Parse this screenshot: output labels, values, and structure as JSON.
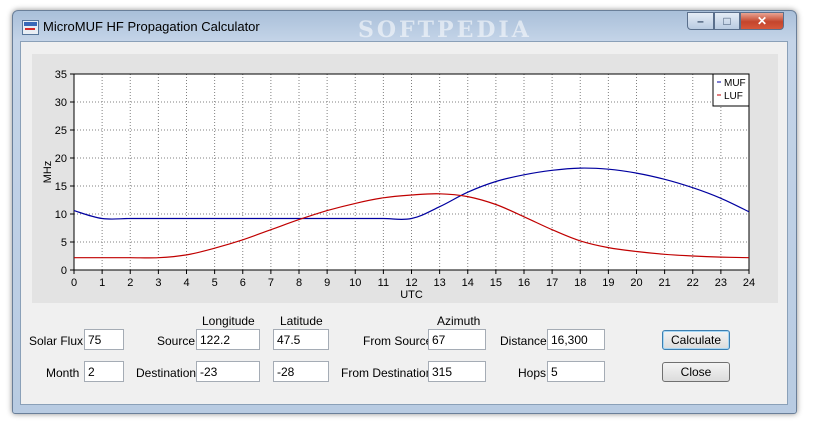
{
  "window": {
    "title": "MicroMUF HF Propagation Calculator",
    "watermark": "SOFTPEDIA",
    "buttons": {
      "minimize_icon": "minimize-icon",
      "maximize_icon": "maximize-icon",
      "close_icon": "close-icon"
    }
  },
  "chart_data": {
    "type": "line",
    "xlabel": "UTC",
    "ylabel": "MHz",
    "xlim": [
      0,
      24
    ],
    "ylim": [
      0,
      35
    ],
    "xticks": [
      "0",
      "1",
      "2",
      "3",
      "4",
      "5",
      "6",
      "7",
      "8",
      "9",
      "10",
      "11",
      "12",
      "13",
      "14",
      "15",
      "16",
      "17",
      "18",
      "19",
      "20",
      "21",
      "22",
      "23",
      "24"
    ],
    "yticks": [
      "0",
      "5",
      "10",
      "15",
      "20",
      "25",
      "30",
      "35"
    ],
    "grid": true,
    "legend_position": "top-right",
    "series": [
      {
        "name": "MUF",
        "color": "#0000a0",
        "x": [
          0,
          1,
          2,
          3,
          4,
          5,
          6,
          7,
          8,
          9,
          10,
          11,
          12,
          13,
          14,
          15,
          16,
          17,
          18,
          19,
          20,
          21,
          22,
          23,
          24
        ],
        "y": [
          10.6,
          9.2,
          9.2,
          9.2,
          9.2,
          9.2,
          9.2,
          9.2,
          9.2,
          9.2,
          9.2,
          9.2,
          9.2,
          11.3,
          13.9,
          15.8,
          17.0,
          17.8,
          18.2,
          18.0,
          17.3,
          16.2,
          14.7,
          12.8,
          10.4
        ]
      },
      {
        "name": "LUF",
        "color": "#c00000",
        "x": [
          0,
          1,
          2,
          3,
          4,
          5,
          6,
          7,
          8,
          9,
          10,
          11,
          12,
          13,
          14,
          15,
          16,
          17,
          18,
          19,
          20,
          21,
          22,
          23,
          24
        ],
        "y": [
          2.2,
          2.2,
          2.2,
          2.2,
          2.7,
          3.9,
          5.4,
          7.2,
          9.0,
          10.6,
          11.9,
          12.9,
          13.4,
          13.6,
          13.1,
          11.7,
          9.5,
          7.2,
          5.2,
          4.0,
          3.3,
          2.8,
          2.5,
          2.3,
          2.2
        ]
      }
    ]
  },
  "form": {
    "headers": {
      "longitude": "Longitude",
      "latitude": "Latitude",
      "azimuth": "Azimuth"
    },
    "solar_flux": {
      "label": "Solar Flux",
      "value": "75"
    },
    "month": {
      "label": "Month",
      "value": "2"
    },
    "source": {
      "label": "Source",
      "longitude": "122.2",
      "latitude": "47.5"
    },
    "destination": {
      "label": "Destination",
      "longitude": "-23",
      "latitude": "-28"
    },
    "from_source": {
      "label": "From Source",
      "value": "67"
    },
    "from_destination": {
      "label": "From Destination",
      "value": "315"
    },
    "distance": {
      "label": "Distance",
      "value": "16,300"
    },
    "hops": {
      "label": "Hops",
      "value": "5"
    },
    "calculate_label": "Calculate",
    "close_label": "Close"
  }
}
